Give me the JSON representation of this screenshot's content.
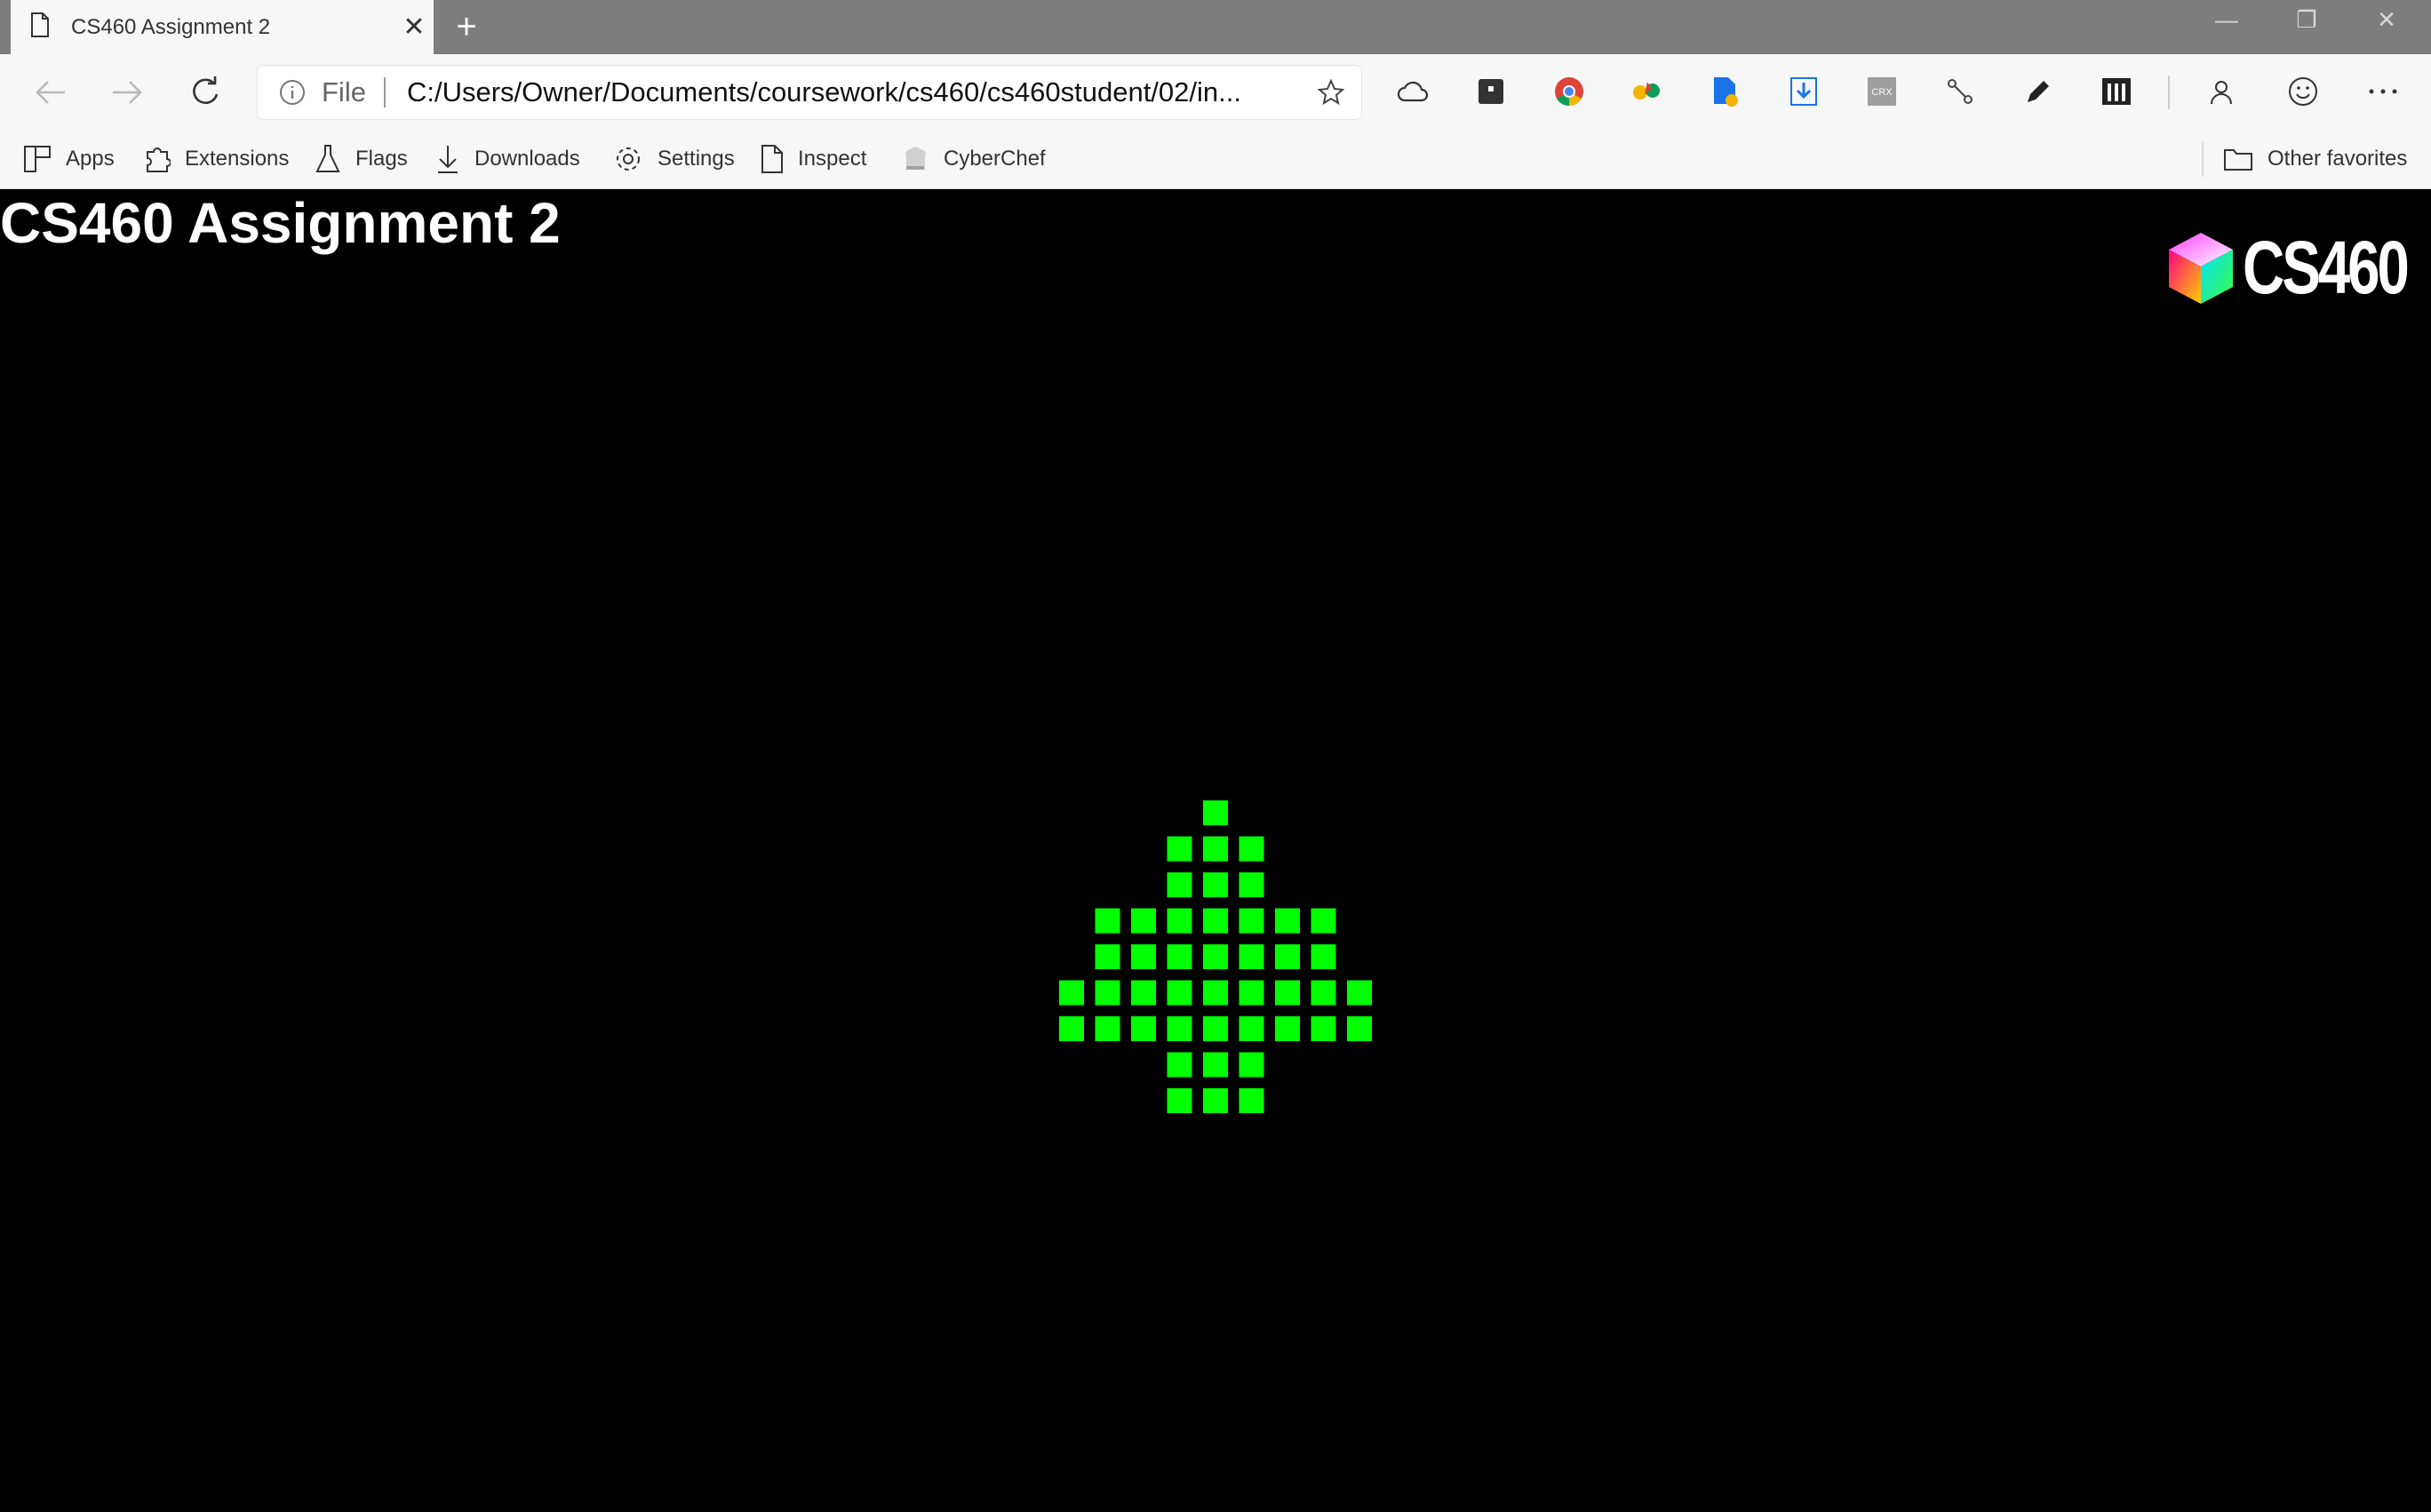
{
  "browser": {
    "tab_title": "CS460 Assignment 2",
    "new_tab_symbol": "+",
    "address_scheme": "File",
    "address_url": "C:/Users/Owner/Documents/coursework/cs460/cs460student/02/in...",
    "extensions": [
      "cloud-icon",
      "dark-box-icon",
      "chrome-icon",
      "colorful-extension-icon",
      "document-download-icon",
      "download-arrow-icon",
      "crx-icon",
      "scissors-icon",
      "pencil-icon",
      "columns-icon"
    ],
    "bookmarks": [
      {
        "label": "Apps",
        "icon": "apps-grid-icon"
      },
      {
        "label": "Extensions",
        "icon": "puzzle-icon"
      },
      {
        "label": "Flags",
        "icon": "flask-icon"
      },
      {
        "label": "Downloads",
        "icon": "download-icon"
      },
      {
        "label": "Settings",
        "icon": "gear-icon"
      },
      {
        "label": "Inspect",
        "icon": "page-icon"
      },
      {
        "label": "CyberChef",
        "icon": "chef-hat-icon"
      }
    ],
    "other_favorites": "Other favorites"
  },
  "page": {
    "heading": "CS460 Assignment 2",
    "logo_text": "CS460",
    "dot_color": "#00ff00",
    "background_color": "#000000",
    "grid_rows": [
      [
        0
      ],
      [
        -1,
        0,
        1
      ],
      [
        -1,
        0,
        1
      ],
      [
        -3,
        -2,
        -1,
        0,
        1,
        2,
        3
      ],
      [
        -3,
        -2,
        -1,
        0,
        1,
        2,
        3
      ],
      [
        -4,
        -3,
        -2,
        -1,
        0,
        1,
        2,
        3,
        4
      ],
      [
        -4,
        -3,
        -2,
        -1,
        0,
        1,
        2,
        3,
        4
      ],
      [
        -1,
        0,
        1
      ],
      [
        -1,
        0,
        1
      ]
    ]
  }
}
